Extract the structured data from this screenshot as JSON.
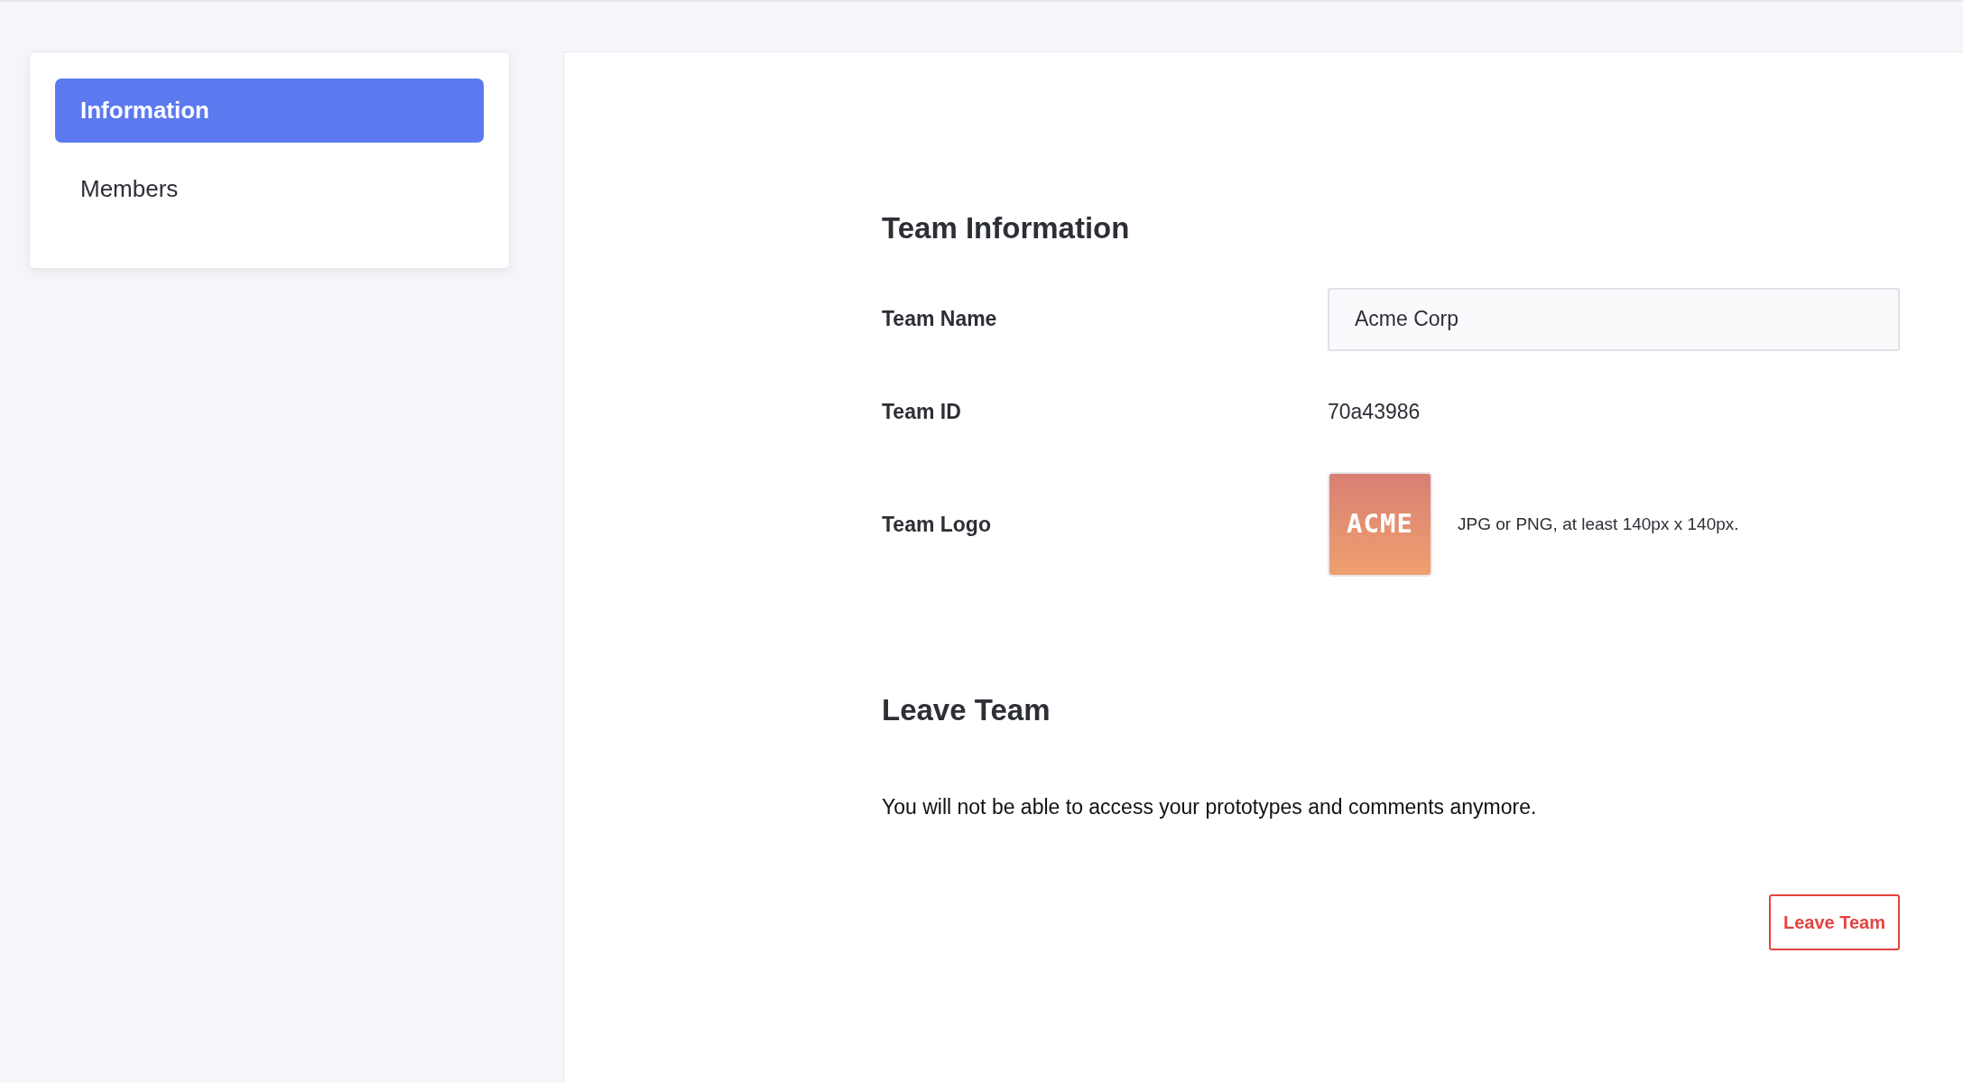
{
  "sidebar": {
    "items": [
      {
        "label": "Information",
        "selected": true
      },
      {
        "label": "Members",
        "selected": false
      }
    ]
  },
  "team_information": {
    "title": "Team Information",
    "fields": [
      {
        "kind": "input",
        "label": "Team Name",
        "value": "Acme Corp"
      },
      {
        "kind": "text",
        "label": "Team ID",
        "value": "70a43986"
      },
      {
        "kind": "logo",
        "label": "Team Logo",
        "logo_text": "ACME",
        "hint": "JPG or PNG, at least 140px x 140px."
      }
    ]
  },
  "leave_team": {
    "title": "Leave Team",
    "description": "You will not be able to access your prototypes and comments anymore.",
    "button": "Leave Team"
  }
}
